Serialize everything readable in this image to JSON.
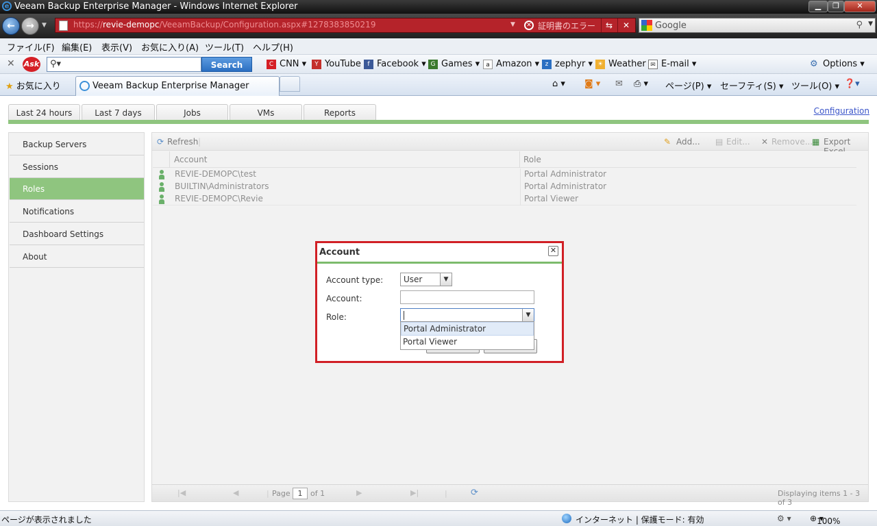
{
  "window": {
    "title": "Veeam Backup Enterprise Manager - Windows Internet Explorer"
  },
  "address": {
    "url_prefix": "https://",
    "url_host": "revie-demopc",
    "url_path": "/VeeamBackup/Configuration.aspx#1278383850219",
    "cert_error": "証明書のエラー",
    "search_placeholder": "Google"
  },
  "menu": [
    "ファイル(F)",
    "編集(E)",
    "表示(V)",
    "お気に入り(A)",
    "ツール(T)",
    "ヘルプ(H)"
  ],
  "ask_toolbar": {
    "logo": "Ask",
    "search_button": "Search",
    "links": [
      "CNN",
      "YouTube",
      "Facebook",
      "Games",
      "Amazon",
      "zephyr",
      "Weather",
      "E-mail"
    ],
    "options": "Options"
  },
  "tabs_bar": {
    "favorites": "お気に入り",
    "active_tab": "Veeam Backup Enterprise Manager",
    "commands": [
      "ページ(P)",
      "セーフティ(S)",
      "ツール(O)"
    ]
  },
  "app": {
    "top_tabs": [
      "Last 24 hours",
      "Last 7 days",
      "Jobs",
      "VMs",
      "Reports"
    ],
    "configuration_link": "Configuration",
    "sidebar": [
      {
        "label": "Backup Servers",
        "active": false
      },
      {
        "label": "Sessions",
        "active": false
      },
      {
        "label": "Roles",
        "active": true
      },
      {
        "label": "Notifications",
        "active": false
      },
      {
        "label": "Dashboard Settings",
        "active": false
      },
      {
        "label": "About",
        "active": false
      }
    ],
    "toolbar": {
      "refresh": "Refresh",
      "add": "Add...",
      "edit": "Edit...",
      "remove": "Remove...",
      "export": "Export Excel"
    },
    "grid": {
      "columns": [
        "Account",
        "Role"
      ],
      "rows": [
        {
          "account": "REVIE-DEMOPC\\test",
          "role": "Portal Administrator"
        },
        {
          "account": "BUILTIN\\Administrators",
          "role": "Portal Administrator"
        },
        {
          "account": "REVIE-DEMOPC\\Revie",
          "role": "Portal Viewer"
        }
      ]
    },
    "pager": {
      "page_label": "Page",
      "page_value": "1",
      "of_label": "of 1",
      "summary": "Displaying items 1 - 3 of 3"
    }
  },
  "dialog": {
    "title": "Account",
    "account_type_label": "Account type:",
    "account_type_value": "User",
    "account_label": "Account:",
    "role_label": "Role:",
    "role_options": [
      "Portal Administrator",
      "Portal Viewer"
    ]
  },
  "status": {
    "left": "ページが表示されました",
    "zone": "インターネット | 保護モード: 有効",
    "zoom": "100%"
  },
  "colors": {
    "accent_green": "#8fc57f",
    "dialog_border": "#d11f25",
    "url_bar_error": "#b5232a"
  }
}
